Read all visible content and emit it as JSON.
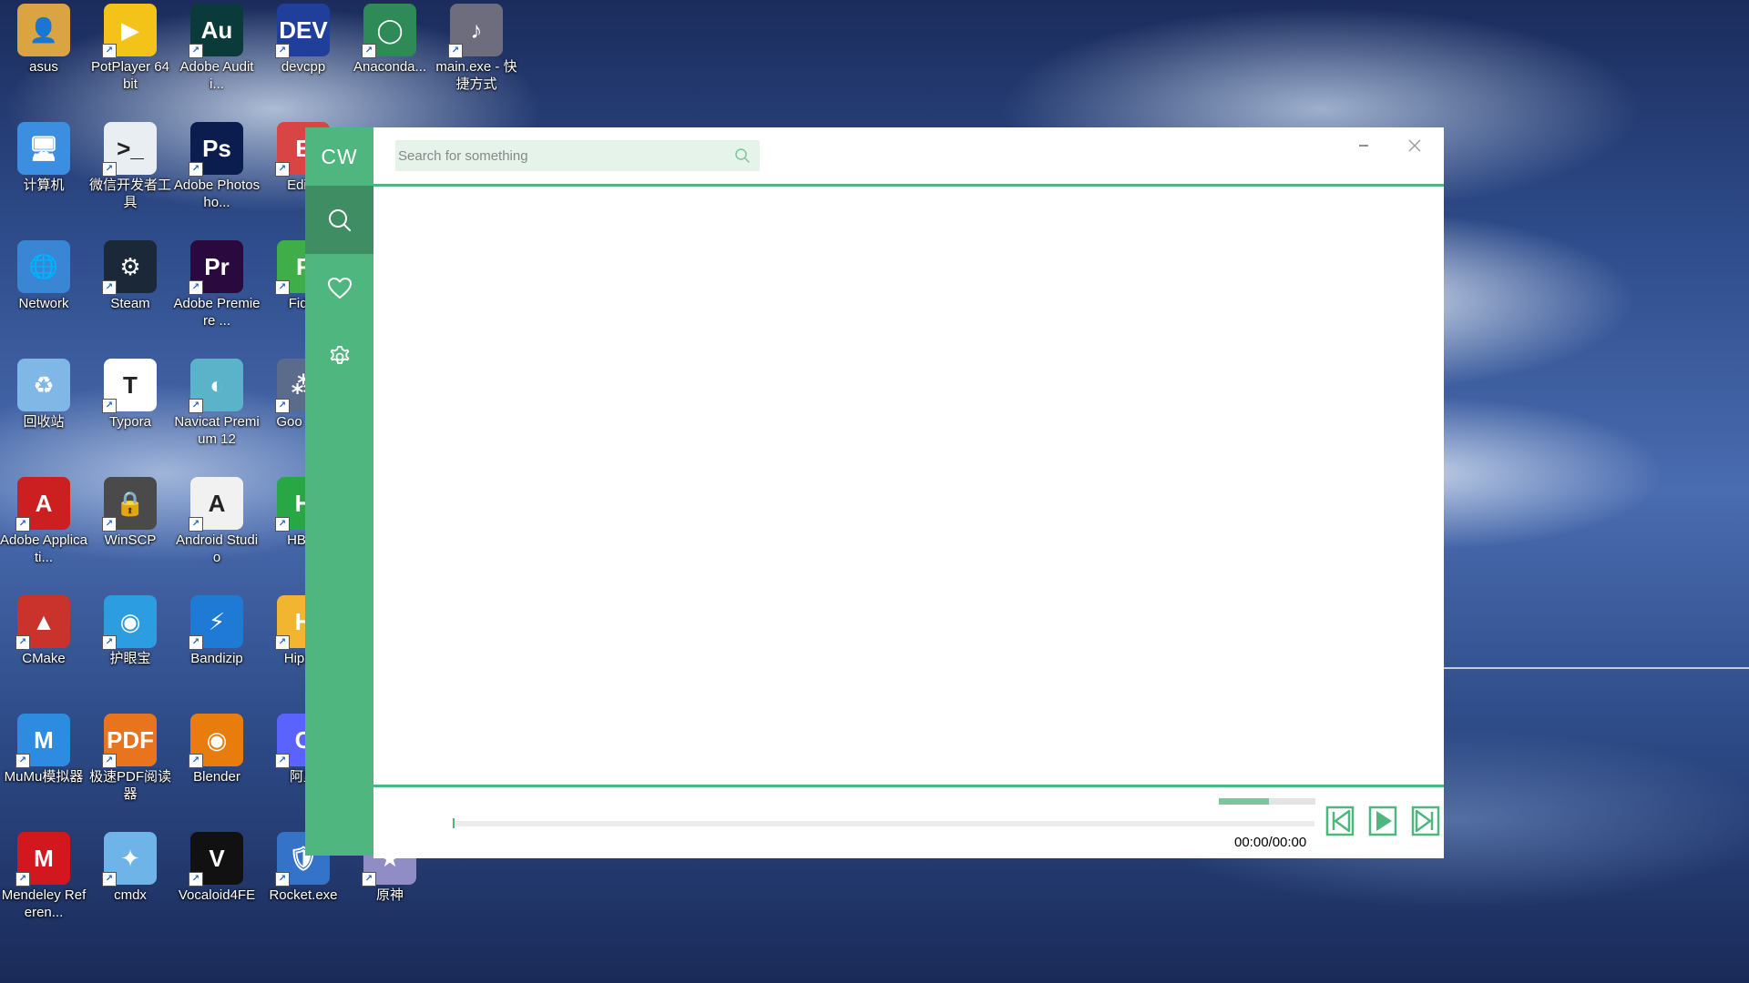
{
  "desktop": {
    "icons": [
      {
        "label": "asus",
        "color": "#d9a441",
        "glyph": "👤"
      },
      {
        "label": "PotPlayer 64 bit",
        "color": "#f3c319",
        "glyph": "▶"
      },
      {
        "label": "Adobe Auditi...",
        "color": "#0b3a3a",
        "glyph": "Au"
      },
      {
        "label": "devcpp",
        "color": "#1f3f9a",
        "glyph": "DEV"
      },
      {
        "label": "Anaconda...",
        "color": "#2e8b57",
        "glyph": "◯"
      },
      {
        "label": "main.exe - 快捷方式",
        "color": "#6d6d7e",
        "glyph": "♪"
      },
      {
        "label": "计算机",
        "color": "#3b8ee0",
        "glyph": "🖥"
      },
      {
        "label": "微信开发者工具",
        "color": "#e9eef2",
        "glyph": ">_"
      },
      {
        "label": "Adobe Photosho...",
        "color": "#0b1d4e",
        "glyph": "Ps"
      },
      {
        "label": "EditP",
        "color": "#d94444",
        "glyph": "E"
      },
      {
        "label": "Network",
        "color": "#3a86d4",
        "glyph": "🌐"
      },
      {
        "label": "Steam",
        "color": "#1b2838",
        "glyph": "⚙"
      },
      {
        "label": "Adobe Premiere ...",
        "color": "#2a0a3e",
        "glyph": "Pr"
      },
      {
        "label": "Fiddl",
        "color": "#3fae49",
        "glyph": "F"
      },
      {
        "label": "回收站",
        "color": "#7fb7e6",
        "glyph": "♻"
      },
      {
        "label": "Typora",
        "color": "#ffffff",
        "glyph": "T"
      },
      {
        "label": "Navicat Premium 12",
        "color": "#5bb3c9",
        "glyph": "◐"
      },
      {
        "label": "Goo Eng",
        "color": "#5a6b8c",
        "glyph": "⁂"
      },
      {
        "label": "Adobe Applicati...",
        "color": "#cc1f1f",
        "glyph": "A"
      },
      {
        "label": "WinSCP",
        "color": "#4a4a4a",
        "glyph": "🔒"
      },
      {
        "label": "Android Studio",
        "color": "#f1f1f1",
        "glyph": "A"
      },
      {
        "label": "HBuil",
        "color": "#2aa745",
        "glyph": "H"
      },
      {
        "label": "CMake",
        "color": "#c9332b",
        "glyph": "▲"
      },
      {
        "label": "护眼宝",
        "color": "#2c9de0",
        "glyph": "◉"
      },
      {
        "label": "Bandizip",
        "color": "#1f7ad6",
        "glyph": "⚡"
      },
      {
        "label": "HipsM",
        "color": "#f2b530",
        "glyph": "H"
      },
      {
        "label": "MuMu模拟器",
        "color": "#2d8be0",
        "glyph": "M"
      },
      {
        "label": "极速PDF阅读器",
        "color": "#e8741e",
        "glyph": "PDF"
      },
      {
        "label": "Blender",
        "color": "#e87d0d",
        "glyph": "◉"
      },
      {
        "label": "阿里",
        "color": "#5b63ff",
        "glyph": "C"
      },
      {
        "label": "Mendeley Referen...",
        "color": "#d3171e",
        "glyph": "M"
      },
      {
        "label": "cmdx",
        "color": "#6fb4e8",
        "glyph": "✦"
      },
      {
        "label": "Vocaloid4FE",
        "color": "#111111",
        "glyph": "V"
      },
      {
        "label": "Rocket.exe",
        "color": "#3573c9",
        "glyph": "🛡"
      },
      {
        "label": "原神",
        "color": "#8f8cc6",
        "glyph": "★"
      }
    ]
  },
  "app": {
    "logo": "CW",
    "nav": [
      {
        "name": "search",
        "icon": "search-icon",
        "active": true
      },
      {
        "name": "favorites",
        "icon": "heart-icon",
        "active": false
      },
      {
        "name": "settings",
        "icon": "gear-icon",
        "active": false
      }
    ],
    "search": {
      "placeholder": "Search for something",
      "value": ""
    },
    "window_controls": {
      "minimize": "–",
      "close": "×"
    },
    "player": {
      "time": "00:00/00:00",
      "progress": 0,
      "volume": 0.52
    },
    "colors": {
      "accent": "#4fb67f",
      "accent_dark": "#3e8d63",
      "search_bg": "#e5f3ea"
    }
  }
}
